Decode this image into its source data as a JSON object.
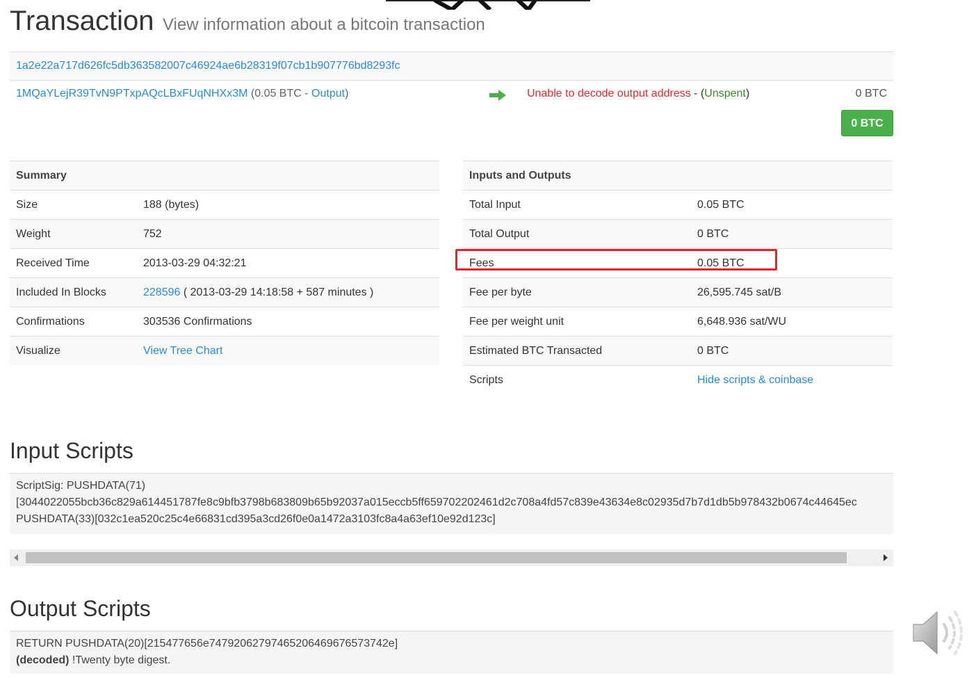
{
  "header": {
    "title": "Transaction",
    "subtitle": "View information about a bitcoin transaction"
  },
  "transaction": {
    "hash": "1a2e22a717d626fc5db363582007c46924ae6b28319f07cb1b907776bd8293fc",
    "input_address": "1MQaYLejR39TvN9PTxpAQcLBxFUqNHXx3M",
    "input_amount_open": "(0.05 BTC - ",
    "input_output_link": "Output",
    "input_close": ")",
    "output_error": "Unable to decode output address",
    "output_sep": " - (",
    "output_status": "Unspent",
    "output_close": ")",
    "output_value": "0 BTC",
    "total_badge": "0 BTC"
  },
  "summary": {
    "heading": "Summary",
    "rows": [
      {
        "label": "Size",
        "value": "188 (bytes)"
      },
      {
        "label": "Weight",
        "value": "752"
      },
      {
        "label": "Received Time",
        "value": "2013-03-29 04:32:21"
      },
      {
        "label": "Included In Blocks",
        "block": "228596",
        "block_detail": " ( 2013-03-29 14:18:58 + 587 minutes )"
      },
      {
        "label": "Confirmations",
        "value": "303536 Confirmations"
      },
      {
        "label": "Visualize",
        "link": "View Tree Chart"
      }
    ]
  },
  "inputs_outputs": {
    "heading": "Inputs and Outputs",
    "rows": [
      {
        "label": "Total Input",
        "value": "0.05 BTC"
      },
      {
        "label": "Total Output",
        "value": "0 BTC"
      },
      {
        "label": "Fees",
        "value": "0.05 BTC"
      },
      {
        "label": "Fee per byte",
        "value": "26,595.745 sat/B"
      },
      {
        "label": "Fee per weight unit",
        "value": "6,648.936 sat/WU"
      },
      {
        "label": "Estimated BTC Transacted",
        "value": "0 BTC"
      },
      {
        "label": "Scripts",
        "link": "Hide scripts & coinbase"
      }
    ]
  },
  "input_scripts": {
    "heading": "Input Scripts",
    "lines": [
      "ScriptSig: PUSHDATA(71)",
      "[3044022055bcb36c829a614451787fe8c9bfb3798b683809b65b92037a015eccb5ff659702202461d2c708a4fd57c839e43634e8c02935d7b7d1db5b978432b0674c44645ec",
      "PUSHDATA(33)[032c1ea520c25c4e66831cd395a3cd26f0e0a1472a3103fc8a4a63ef10e92d123c]"
    ]
  },
  "output_scripts": {
    "heading": "Output Scripts",
    "line1": "RETURN PUSHDATA(20)[215477656e74792062797465206469676573742e]",
    "decoded_label": "(decoded)",
    "decoded_text": " !Twenty byte digest."
  },
  "colors": {
    "link": "#2a8ad6",
    "error": "#e32b2b",
    "unspent": "#3c8a2c",
    "badge": "#4cb04c",
    "highlight": "#e8212e"
  },
  "icons": [
    "arrow-right-icon",
    "scroll-left-arrow-icon",
    "scroll-right-arrow-icon",
    "speaker-volume-icon"
  ]
}
